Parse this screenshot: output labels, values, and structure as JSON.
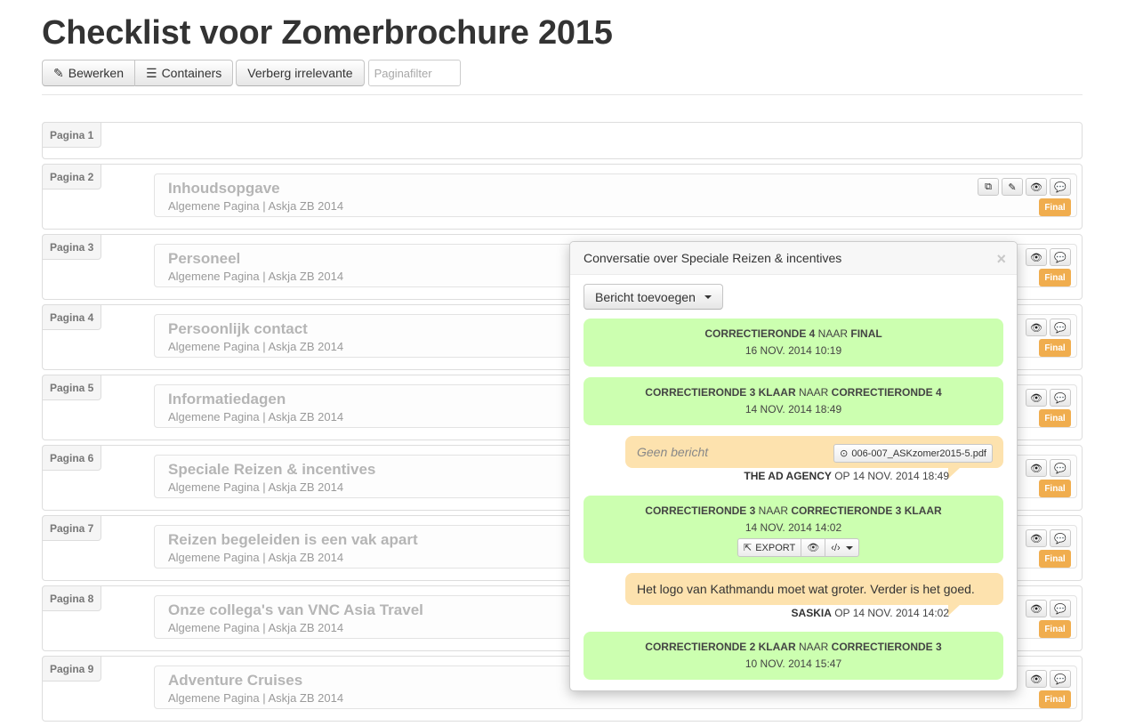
{
  "title": "Checklist voor Zomerbrochure 2015",
  "toolbar": {
    "edit": "Bewerken",
    "containers": "Containers",
    "hide_irrelevant": "Verberg irrelevante",
    "filter_placeholder": "Paginafilter"
  },
  "pages": [
    {
      "label": "Pagina 1"
    },
    {
      "label": "Pagina 2",
      "title": "Inhoudsopgave",
      "subtitle": "Algemene Pagina | Askja ZB 2014",
      "badge": "Final"
    },
    {
      "label": "Pagina 3",
      "title": "Personeel",
      "subtitle": "Algemene Pagina | Askja ZB 2014",
      "badge": "Final"
    },
    {
      "label": "Pagina 4",
      "title": "Persoonlijk contact",
      "subtitle": "Algemene Pagina | Askja ZB 2014",
      "badge": "Final"
    },
    {
      "label": "Pagina 5",
      "title": "Informatiedagen",
      "subtitle": "Algemene Pagina | Askja ZB 2014",
      "badge": "Final"
    },
    {
      "label": "Pagina 6",
      "title": "Speciale Reizen & incentives",
      "subtitle": "Algemene Pagina | Askja ZB 2014",
      "badge": "Final"
    },
    {
      "label": "Pagina 7",
      "title": "Reizen begeleiden is een vak apart",
      "subtitle": "Algemene Pagina | Askja ZB 2014",
      "badge": "Final"
    },
    {
      "label": "Pagina 8",
      "title": "Onze collega's van VNC Asia Travel",
      "subtitle": "Algemene Pagina | Askja ZB 2014",
      "badge": "Final"
    },
    {
      "label": "Pagina 9",
      "title": "Adventure Cruises",
      "subtitle": "Algemene Pagina | Askja ZB 2014",
      "badge": "Final"
    }
  ],
  "popover": {
    "title": "Conversatie over Speciale Reizen & incentives",
    "close": "×",
    "add_message": "Bericht toevoegen",
    "messages": [
      {
        "type": "status",
        "from": "CORRECTIERONDE 4",
        "to_word": "NAAR",
        "to": "FINAL",
        "date": "16 NOV. 2014 10:19"
      },
      {
        "type": "status",
        "from": "CORRECTIERONDE 3 KLAAR",
        "to_word": "NAAR",
        "to": "CORRECTIERONDE 4",
        "date": "14 NOV. 2014 18:49"
      },
      {
        "type": "comment",
        "text": "Geen bericht",
        "file": "006-007_ASKzomer2015-5.pdf",
        "author": "THE AD AGENCY",
        "on_word": "OP",
        "date": "14 NOV. 2014 18:49"
      },
      {
        "type": "status",
        "from": "CORRECTIERONDE 3",
        "to_word": "NAAR",
        "to": "CORRECTIERONDE 3 KLAAR",
        "date": "14 NOV. 2014 14:02",
        "export": "EXPORT"
      },
      {
        "type": "comment",
        "text": "Het logo van Kathmandu moet wat groter. Verder is het goed.",
        "author": "SASKIA",
        "on_word": "OP",
        "date": "14 NOV. 2014 14:02"
      },
      {
        "type": "status",
        "from": "CORRECTIERONDE 2 KLAAR",
        "to_word": "NAAR",
        "to": "CORRECTIERONDE 3",
        "date": "10 NOV. 2014 15:47"
      }
    ]
  },
  "colors": {
    "status_bubble": "#ccffb0",
    "comment_bubble": "#fde2ae",
    "final_badge": "#f0ad4e"
  }
}
